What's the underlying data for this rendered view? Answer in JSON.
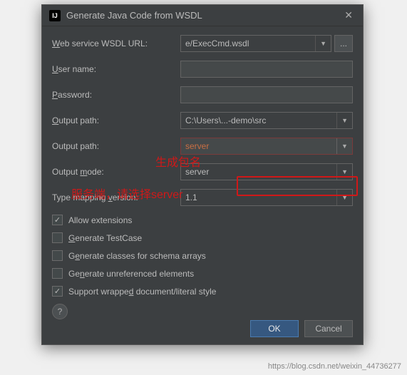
{
  "dialog": {
    "title": "Generate Java Code from WSDL",
    "app_icon_text": "IJ"
  },
  "fields": {
    "wsdl_url_label": "Web service WSDL URL:",
    "wsdl_url_value": "e/ExecCmd.wsdl",
    "user_name_label": "User name:",
    "user_name_value": "",
    "password_label": "Password:",
    "password_value": "",
    "output_path_label": "Output path:",
    "output_path_value": "C:\\Users\\...-demo\\src",
    "output_package_label": "Output path:",
    "output_package_value": "server",
    "output_mode_label": "Output mode:",
    "output_mode_value": "server",
    "type_mapping_label": "Type mapping version:",
    "type_mapping_value": "1.1"
  },
  "checkboxes": {
    "allow_extensions": {
      "label": "Allow extensions",
      "checked": true
    },
    "generate_testcase": {
      "label": "Generate TestCase",
      "checked": false
    },
    "generate_schema": {
      "label": "Generate classes for schema arrays",
      "checked": false
    },
    "generate_unref": {
      "label": "Generate unreferenced elements",
      "checked": false
    },
    "support_wrapped": {
      "label": "Support wrapped document/literal style",
      "checked": true
    }
  },
  "buttons": {
    "ok": "OK",
    "cancel": "Cancel",
    "ellipsis": "...",
    "help": "?"
  },
  "annotations": {
    "package_hint": "生成包名",
    "server_hint": "服务端，请选择server"
  },
  "watermark": "https://blog.csdn.net/weixin_44736277"
}
